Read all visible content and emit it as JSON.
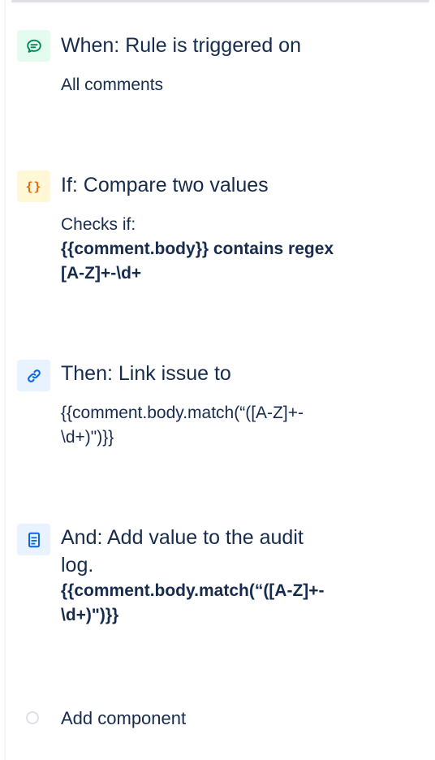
{
  "trigger": {
    "icon": "comment-icon",
    "title": "When: Rule is triggered on",
    "description": "All comments"
  },
  "condition": {
    "icon": "curly-braces-icon",
    "icon_glyph": "{}",
    "title": "If: Compare two values",
    "description_intro": "Checks if:",
    "description_line1": "{{comment.body}} contains regex",
    "description_line2": "[A-Z]+-\\d+"
  },
  "action": {
    "icon": "link-icon",
    "title": "Then: Link issue to",
    "description_line1": "{{comment.body.match(“([A-Z]+-",
    "description_line2": "\\d+)\")}}"
  },
  "audit": {
    "icon": "document-icon",
    "title_line1": "And: Add value to the audit",
    "title_line2": "log.",
    "description_line1": "{{comment.body.match(“([A-Z]+-",
    "description_line2": "\\d+)\")}}"
  },
  "add_component": {
    "label": "Add component"
  },
  "colors": {
    "text": "#172b4d",
    "trigger_bg": "#e3fcef",
    "trigger_icon": "#00875a",
    "condition_bg": "#fff7d6",
    "condition_icon": "#e56910",
    "action_bg": "#e9f2ff",
    "action_icon": "#0c66e4"
  }
}
